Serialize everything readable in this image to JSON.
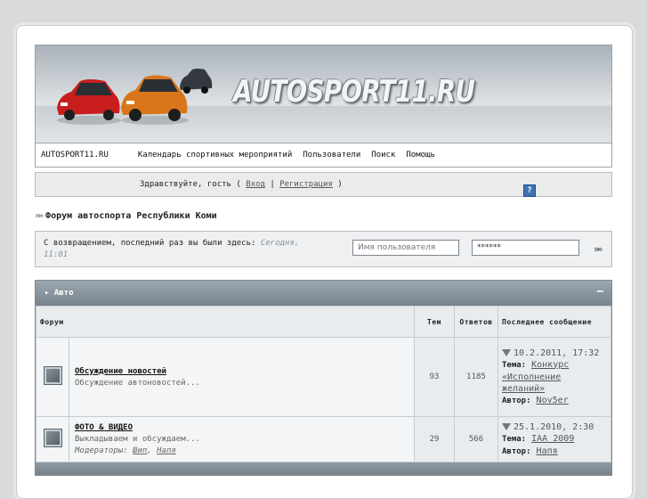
{
  "header": {
    "logo_text": "AUTOSPORT11.RU"
  },
  "menu": {
    "site": "AUTOSPORT11.RU",
    "items": [
      "Календарь спортивных мероприятий",
      "Пользователи",
      "Поиск",
      "Помощь"
    ]
  },
  "greeting": {
    "prefix": "Здравствуйте, гость (",
    "login": "Вход",
    "sep": "|",
    "register": "Регистрация",
    "suffix": ")",
    "help_icon": "?"
  },
  "breadcrumb": {
    "title": "Форум автоспорта Республики Коми"
  },
  "login_box": {
    "welcome": "С возвращением, последний раз вы были здесь:",
    "time1": "Сегодня,",
    "time2": "11:01",
    "username_placeholder": "Имя пользователя",
    "password_value": "******"
  },
  "category": {
    "title": "Авто",
    "collapse": "–",
    "columns": {
      "forum": "Форум",
      "topics": "Тем",
      "replies": "Ответов",
      "last": "Последнее сообщение"
    },
    "forums": [
      {
        "name": "Обсуждение новостей",
        "desc": "Обсуждение автоновостей...",
        "moderators_label": "",
        "moderators": [],
        "topics": "93",
        "replies": "1185",
        "last_date": "10.2.2011, 17:32",
        "topic_label": "Тема:",
        "topic": "Конкурс «Исполнение желаний»",
        "author_label": "Автор:",
        "author": "Nov5er"
      },
      {
        "name": "ФОТО & ВИДЕО",
        "desc": "Выкладываем и обсуждаем...",
        "moderators_label": "Модераторы:",
        "moderators": [
          "Шип",
          "Напя"
        ],
        "topics": "29",
        "replies": "566",
        "last_date": "25.1.2010, 2:30",
        "topic_label": "Тема:",
        "topic": "IAA 2009",
        "author_label": "Автор:",
        "author": "Напя"
      }
    ]
  },
  "colors": {
    "accent": "#7e8a94",
    "help_icon": "#3f73b3",
    "background": "#d9dadb"
  }
}
